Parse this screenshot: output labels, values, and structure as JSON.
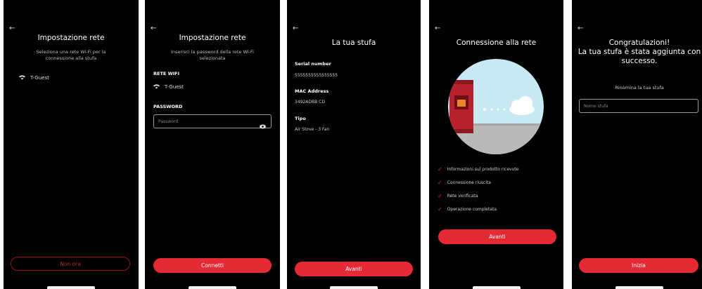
{
  "screen1": {
    "back_icon": "arrow-left-icon",
    "title": "Impostazione rete",
    "subtitle": "Seleziona una rete Wi-Fi per la connessione alla stufa",
    "networks": [
      {
        "icon": "wifi-icon",
        "name": "T-Guest"
      }
    ],
    "secondary_button": "Non ora"
  },
  "screen2": {
    "back_icon": "arrow-left-icon",
    "title": "Impostazione rete",
    "subtitle": "Inserisci la password della rete Wi-Fi selezionata",
    "network_label": "RETE WIFI",
    "network_name": "T-Guest",
    "password_label": "PASSWORD",
    "password_placeholder": "Password",
    "eye_icon": "eye-icon",
    "primary_button": "Connetti"
  },
  "screen3": {
    "back_icon": "arrow-left-icon",
    "title": "La tua stufa",
    "serial_label": "Serial number",
    "serial_value": "5555555555555555",
    "mac_label": "MAC Address",
    "mac_value": "3492ADBB CD",
    "tipo_label": "Tipo",
    "tipo_value": "Air Stove - 3 Fan",
    "primary_button": "Avanti"
  },
  "screen4": {
    "back_icon": "arrow-left-icon",
    "title": "Connessione alla rete",
    "illustration": "stove-to-cloud-illustration",
    "steps": [
      "Informazioni sul prodotto ricevute",
      "Connessione riuscita",
      "Rete verificata",
      "Operazione completata"
    ],
    "primary_button": "Avanti"
  },
  "screen5": {
    "back_icon": "arrow-left-icon",
    "title_line1": "Congratulazioni!",
    "title_line2": "La tua stufa è stata aggiunta con",
    "title_line3": "successo.",
    "rename_label": "Rinomina la tua stufa",
    "name_placeholder": "Nome stufa",
    "primary_button": "Inizia"
  },
  "colors": {
    "accent": "#e52a35",
    "background": "#000000",
    "stove": "#b8212c",
    "circle_bg": "#c8e9f3"
  }
}
